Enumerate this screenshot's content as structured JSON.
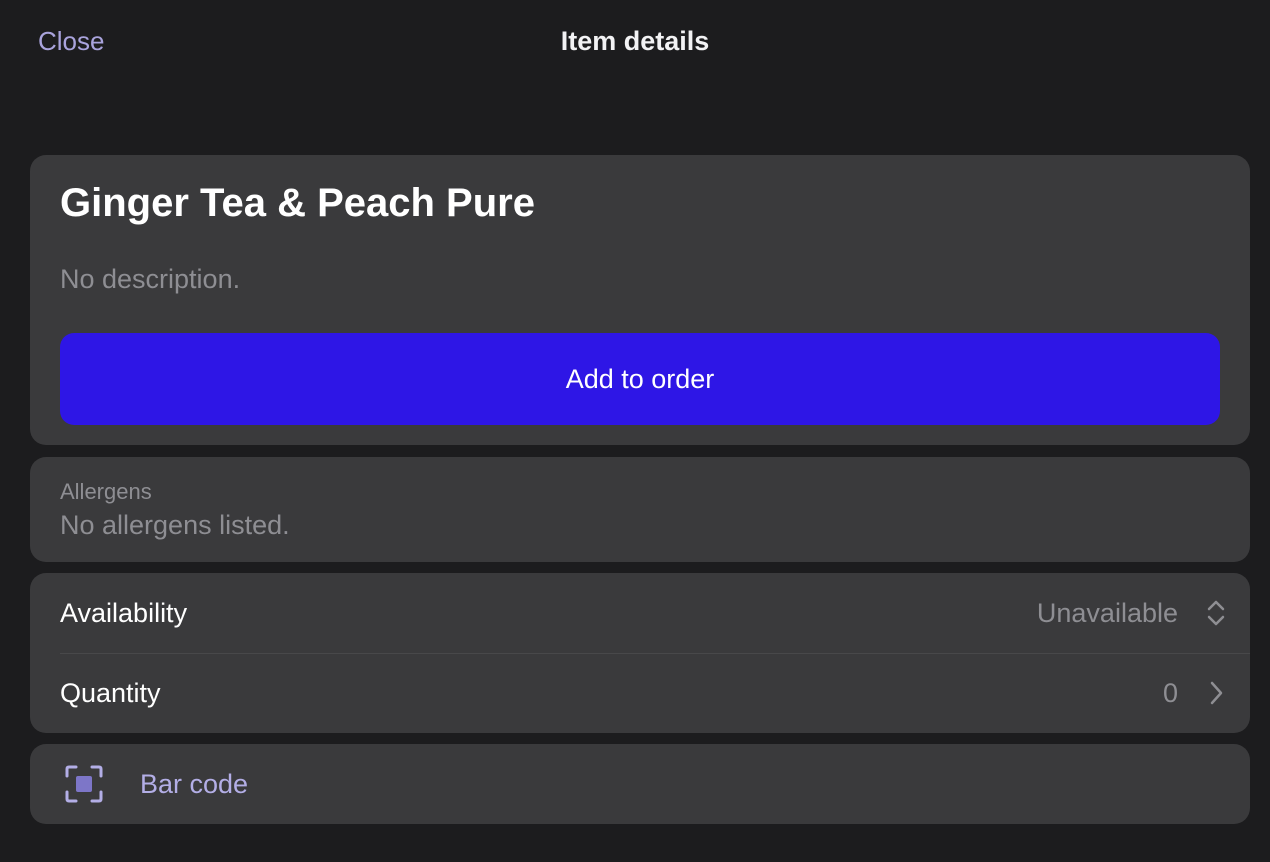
{
  "header": {
    "close_label": "Close",
    "title": "Item details"
  },
  "item": {
    "name": "Ginger Tea & Peach Pure",
    "description": "No description.",
    "add_button_label": "Add to order"
  },
  "allergens": {
    "label": "Allergens",
    "value": "No allergens listed."
  },
  "settings": {
    "availability": {
      "label": "Availability",
      "value": "Unavailable",
      "icon": "chevron-up-down-icon"
    },
    "quantity": {
      "label": "Quantity",
      "value": "0",
      "icon": "chevron-right-icon"
    }
  },
  "barcode": {
    "label": "Bar code",
    "icon": "barcode-scan-icon"
  },
  "colors": {
    "background": "#1c1c1e",
    "card": "#3a3a3c",
    "accent_button": "#2e16e6",
    "link": "#a9a3dc",
    "secondary_text": "#8e8e93"
  }
}
